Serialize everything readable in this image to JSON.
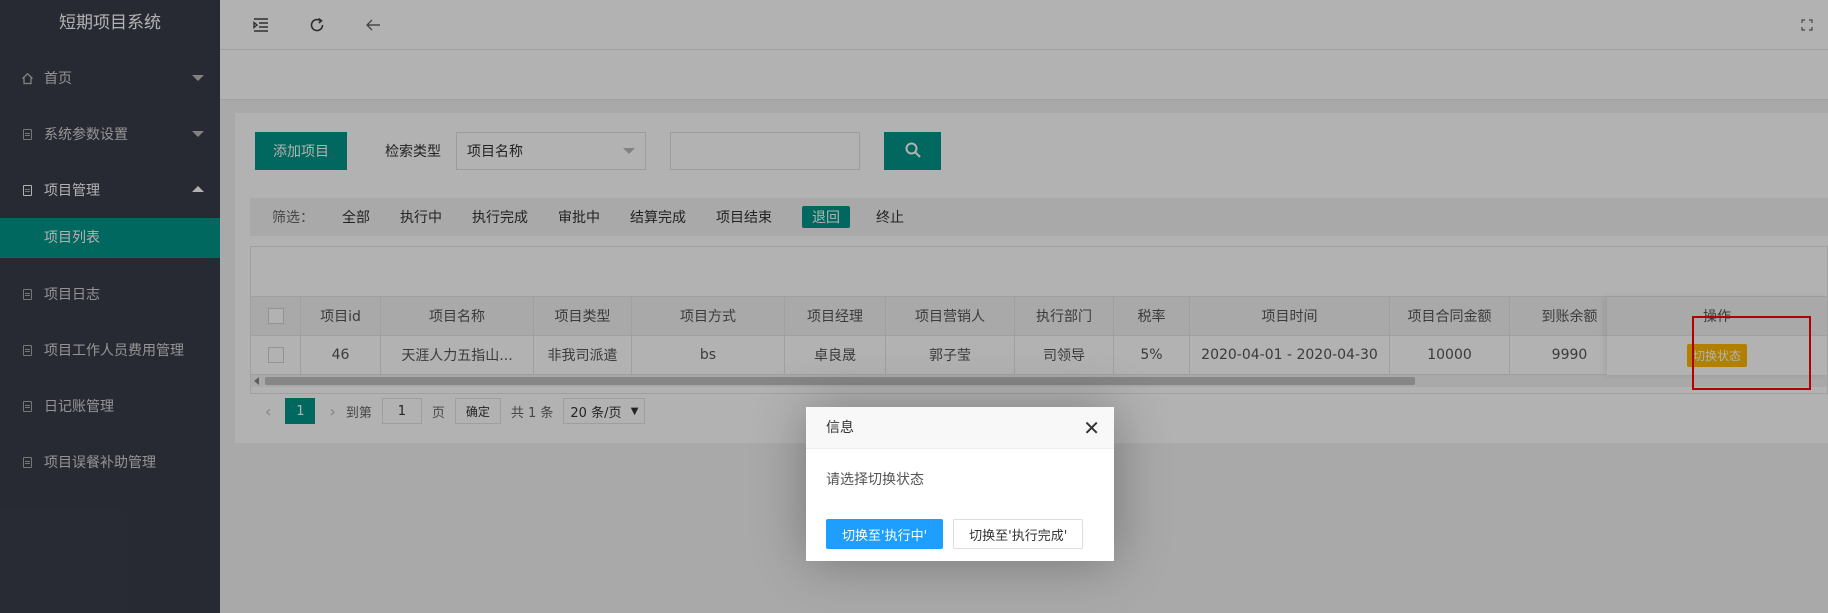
{
  "app": {
    "title": "短期项目系统"
  },
  "sidebar": {
    "items": [
      {
        "label": "首页"
      },
      {
        "label": "系统参数设置"
      },
      {
        "label": "项目管理",
        "sub": "项目列表"
      },
      {
        "label": "项目日志"
      },
      {
        "label": "项目工作人员费用管理"
      },
      {
        "label": "日记账管理"
      },
      {
        "label": "项目误餐补助管理"
      }
    ]
  },
  "toolbar": {
    "add_label": "添加项目",
    "search_type_label": "检索类型",
    "search_type_value": "项目名称",
    "search_placeholder": ""
  },
  "filter": {
    "label": "筛选：",
    "options": [
      "全部",
      "执行中",
      "执行完成",
      "审批中",
      "结算完成",
      "项目结束",
      "退回",
      "终止"
    ],
    "active": "退回"
  },
  "table": {
    "headers": [
      "项目id",
      "项目名称",
      "项目类型",
      "项目方式",
      "项目经理",
      "项目营销人",
      "执行部门",
      "税率",
      "项目时间",
      "项目合同金额",
      "到账余额",
      "操作"
    ],
    "rows": [
      [
        "46",
        "天涯人力五指山...",
        "非我司派遣",
        "bs",
        "卓良晟",
        "郭子莹",
        "司领导",
        "5%",
        "2020-04-01 - 2020-04-30",
        "10000",
        "9990"
      ]
    ],
    "action_label": "切换状态"
  },
  "pager": {
    "current": "1",
    "goto_label": "到第",
    "page_value": "1",
    "page_unit": "页",
    "confirm_label": "确定",
    "total": "共 1 条",
    "page_size": "20 条/页"
  },
  "dialog": {
    "title": "信息",
    "message": "请选择切换状态",
    "btn_primary": "切换至'执行中'",
    "btn_secondary": "切换至'执行完成'"
  }
}
